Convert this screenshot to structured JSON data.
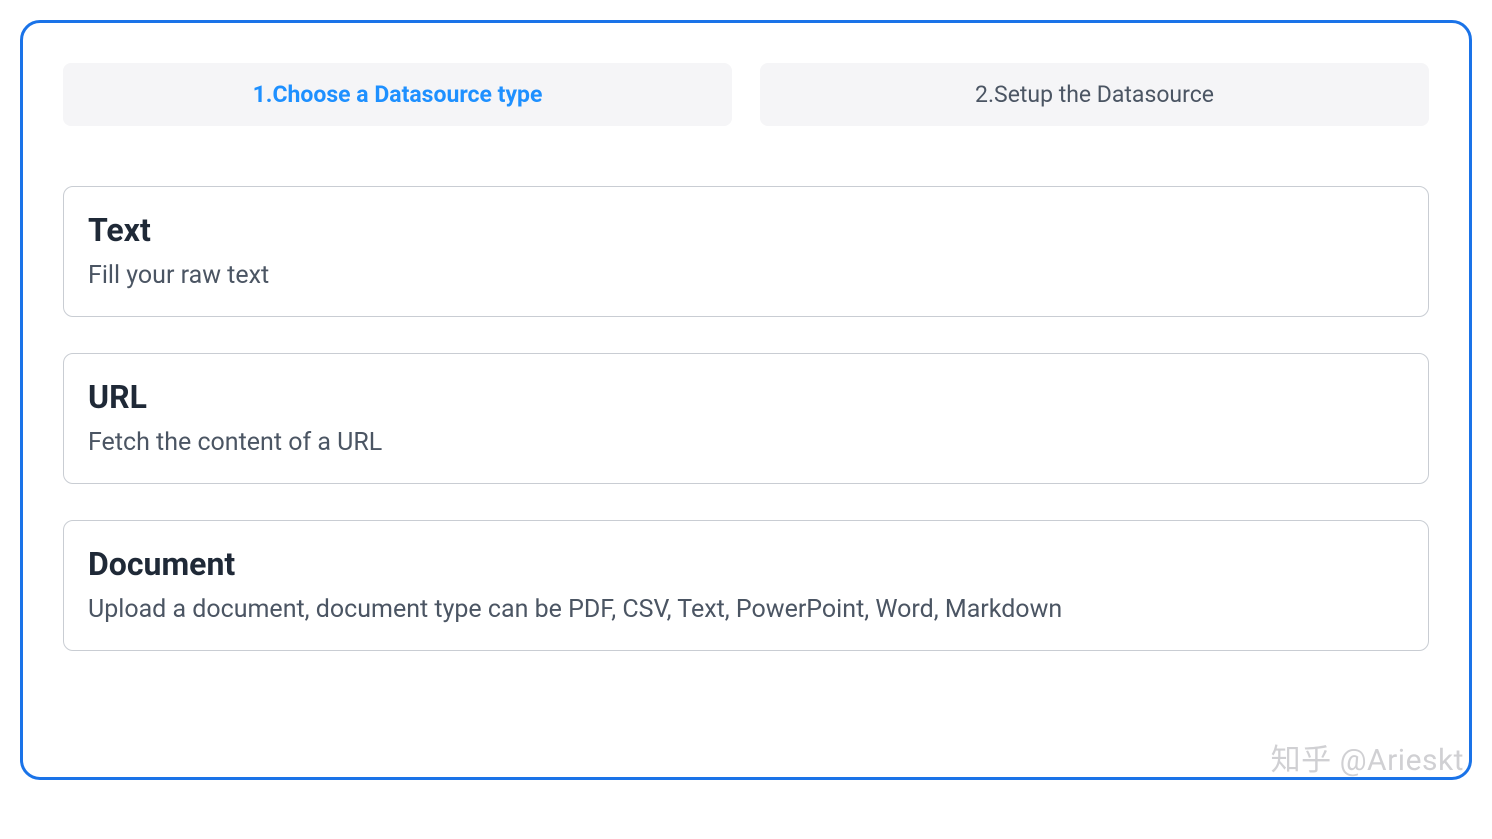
{
  "steps": {
    "step1": "1.Choose a Datasource type",
    "step2": "2.Setup the Datasource"
  },
  "options": {
    "text": {
      "title": "Text",
      "desc": "Fill your raw text"
    },
    "url": {
      "title": "URL",
      "desc": "Fetch the content of a URL"
    },
    "document": {
      "title": "Document",
      "desc": "Upload a document, document type can be PDF, CSV, Text, PowerPoint, Word, Markdown"
    }
  },
  "watermark": "知乎 @Arieskt"
}
